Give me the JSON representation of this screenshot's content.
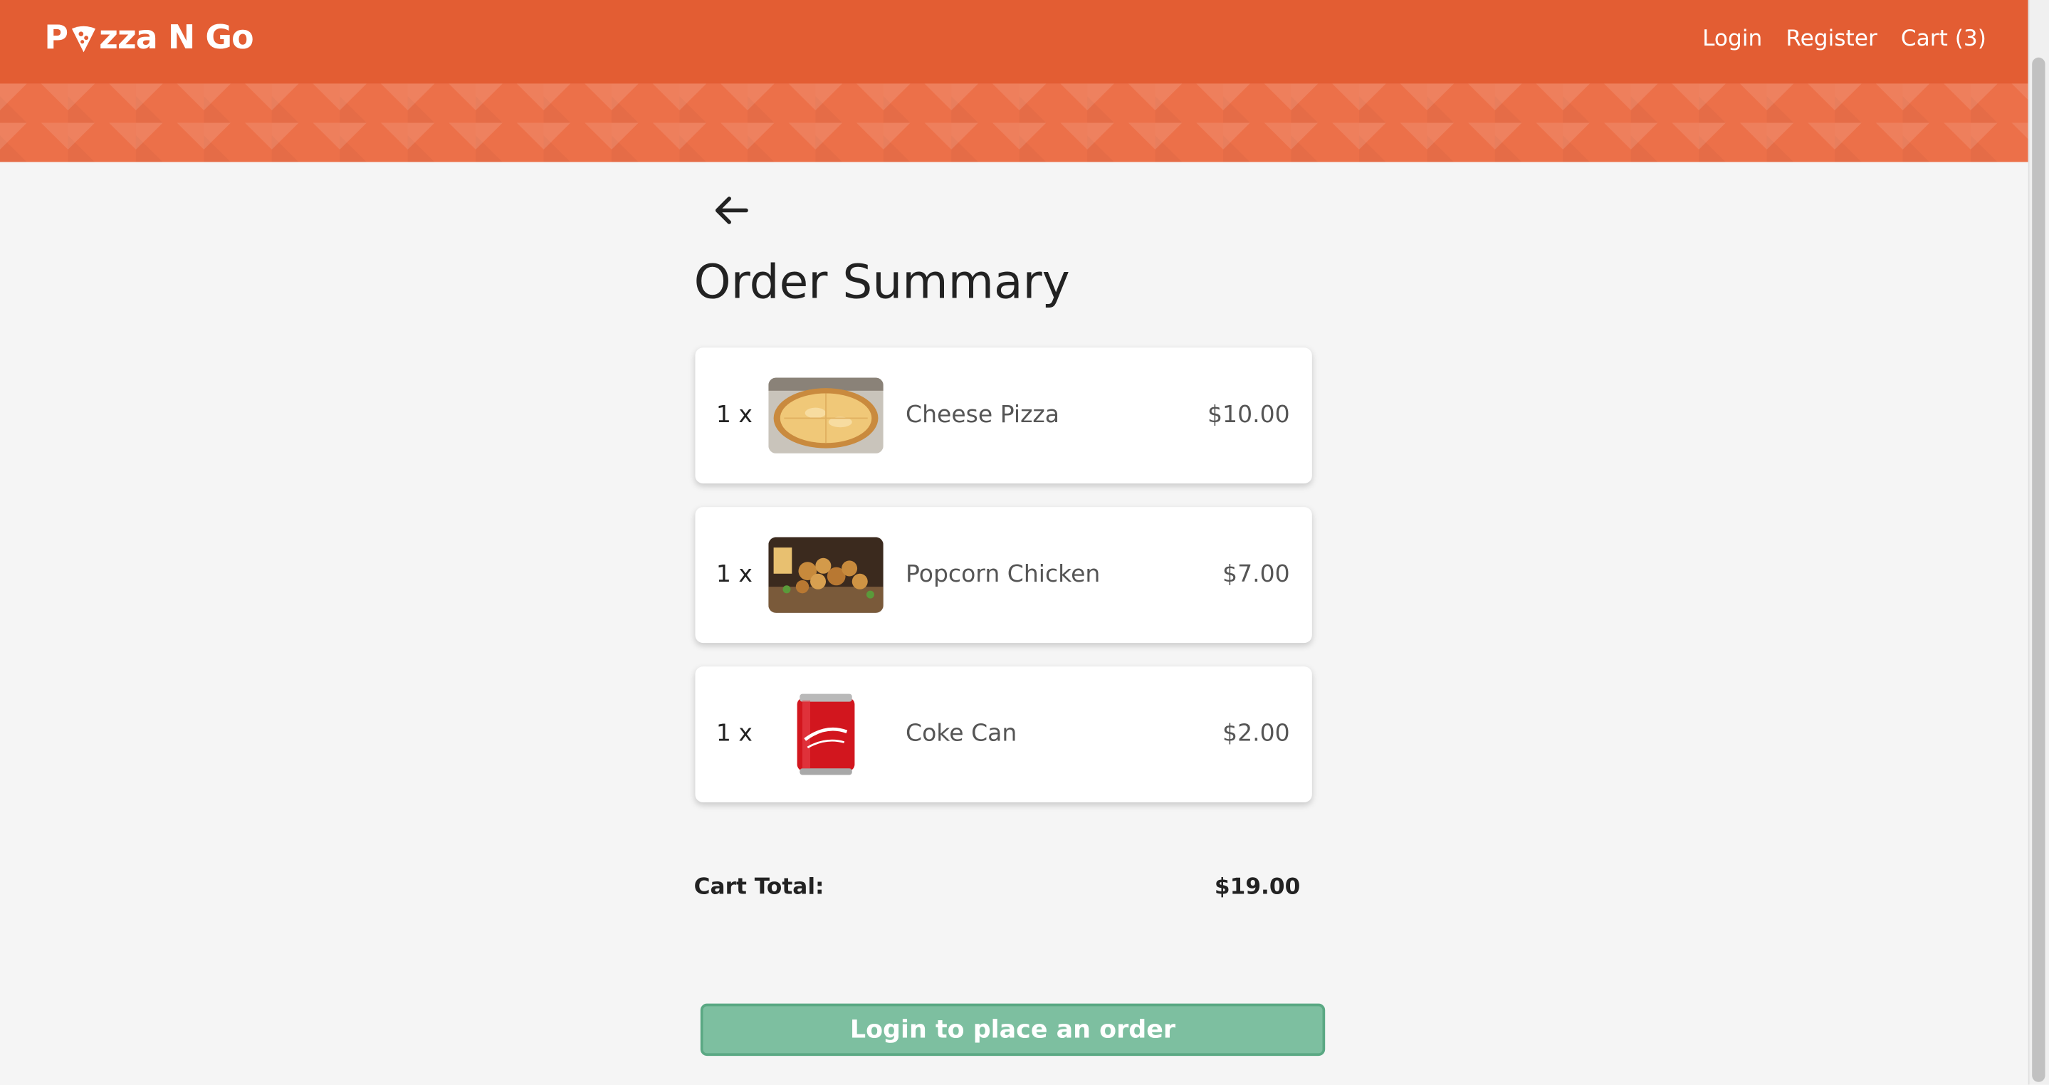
{
  "header": {
    "logo_text_before": "P",
    "logo_text_after": "zza N Go",
    "nav": {
      "login": "Login",
      "register": "Register",
      "cart": "Cart (3)"
    }
  },
  "page": {
    "title": "Order Summary"
  },
  "cart": {
    "items": [
      {
        "quantity": "1 x",
        "name": "Cheese Pizza",
        "price": "$10.00",
        "image": "cheese-pizza"
      },
      {
        "quantity": "1 x",
        "name": "Popcorn Chicken",
        "price": "$7.00",
        "image": "popcorn-chicken"
      },
      {
        "quantity": "1 x",
        "name": "Coke Can",
        "price": "$2.00",
        "image": "coke-can"
      }
    ],
    "total_label": "Cart Total:",
    "total_value": "$19.00"
  },
  "actions": {
    "order_button": "Login to place an order"
  },
  "colors": {
    "brand": "#e35d33",
    "order_button": "#7dbfa0"
  }
}
